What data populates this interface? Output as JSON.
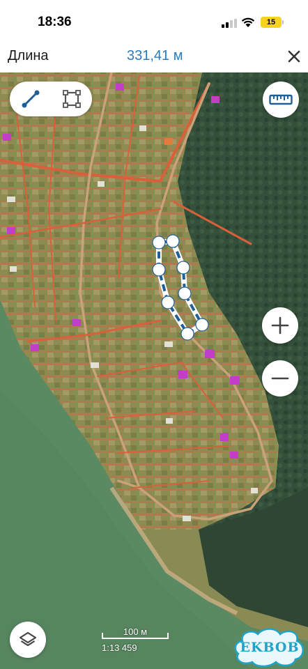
{
  "status_bar": {
    "time": "18:36",
    "battery_level": "15",
    "battery_color": "#f7d21e",
    "icons": [
      "signal-icon",
      "wifi-icon",
      "battery-icon"
    ]
  },
  "header": {
    "title": "Длина",
    "measurement": "331,41 м",
    "measurement_color": "#2b7bbf",
    "close_icon": "close-icon"
  },
  "tools": {
    "line_tool_icon": "line-measure-icon",
    "area_tool_icon": "area-measure-icon",
    "ruler_icon": "ruler-icon",
    "active_color": "#1f5f96"
  },
  "zoom": {
    "zoom_in_icon": "plus-icon",
    "zoom_out_icon": "minus-icon"
  },
  "layers_icon": "layers-icon",
  "scale": {
    "label": "100 м",
    "ratio": "1:13 459"
  },
  "watermark": {
    "text": "EKBOB",
    "color": "#1ea4c8"
  },
  "map": {
    "measure_path_color": "#1f5f96",
    "road_color": "#d9603a",
    "forest_color": "#2f4a34",
    "water_color": "#5b8a62"
  }
}
